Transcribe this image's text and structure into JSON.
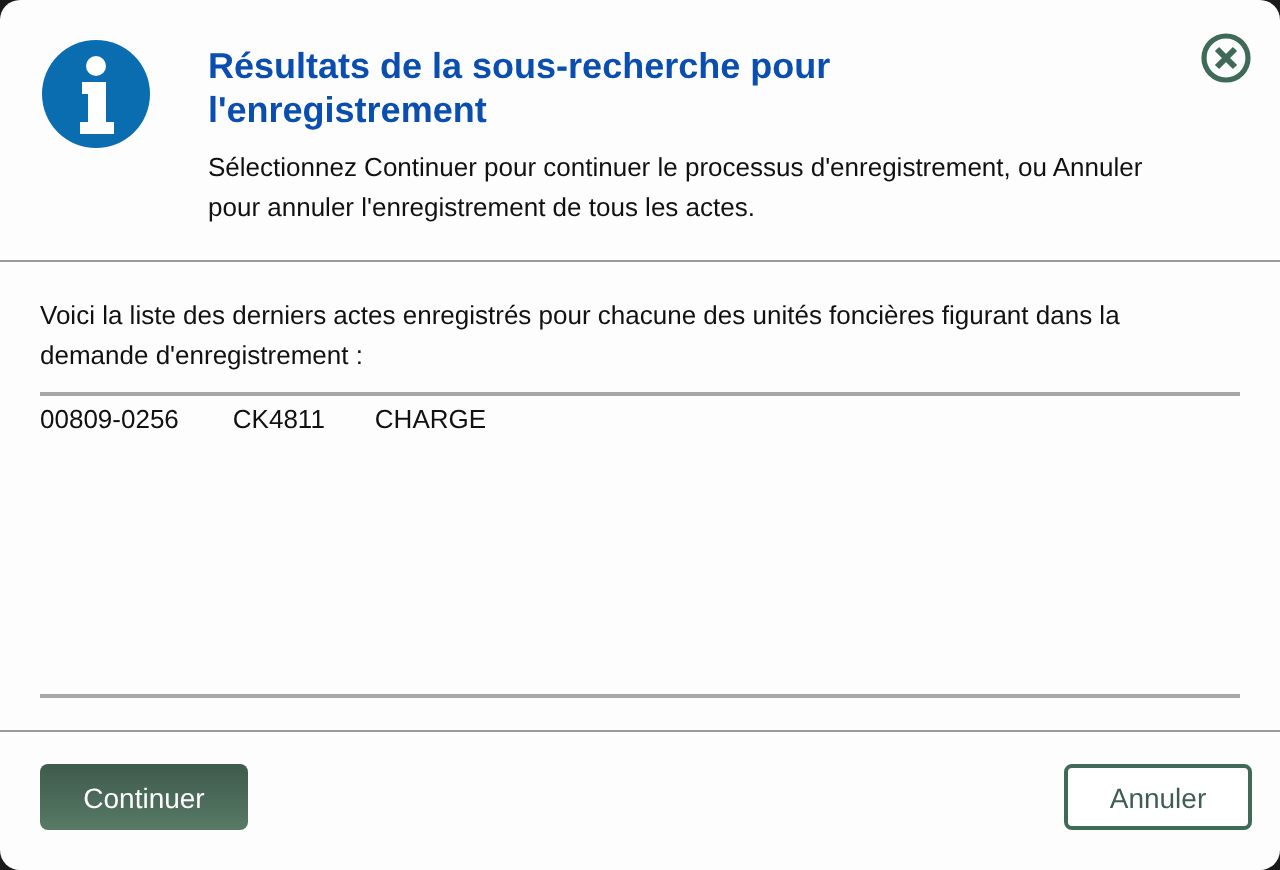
{
  "dialog": {
    "title": "Résultats de la sous-recherche pour l'enregistrement",
    "message": "Sélectionnez Continuer pour continuer le processus d'enregistrement, ou Annuler pour annuler l'enregistrement de tous les actes."
  },
  "body": {
    "intro": "Voici la liste des derniers actes enregistrés pour chacune des unités foncières figurant dans la demande d'enregistrement :",
    "rows": [
      {
        "cells": [
          "00809-0256",
          "CK4811",
          "CHARGE"
        ]
      }
    ]
  },
  "buttons": [
    {
      "label": "Continuer",
      "kind": "primary"
    },
    {
      "label": "Annuler",
      "kind": "secondary"
    }
  ]
}
